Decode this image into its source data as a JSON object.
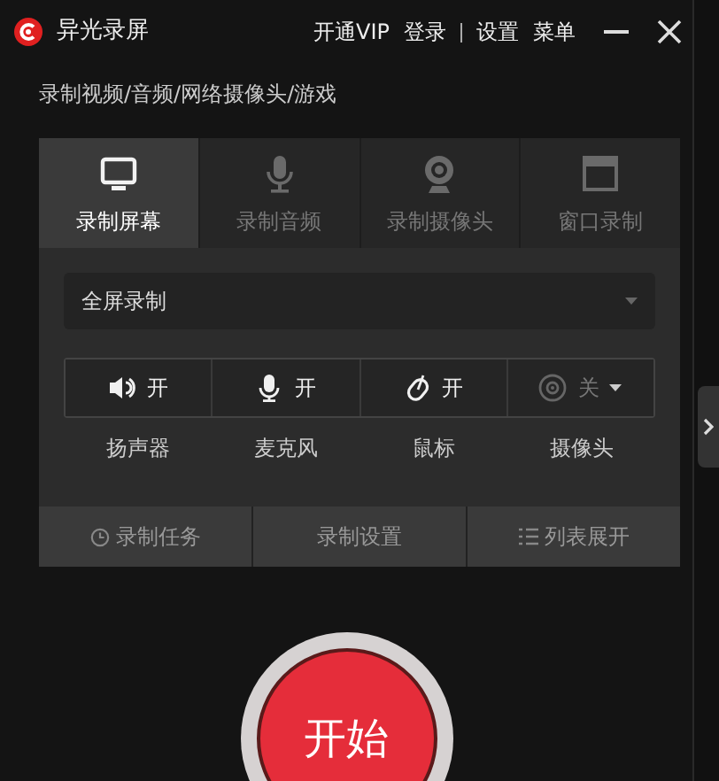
{
  "window": {
    "title": "异光录屏",
    "links": [
      "开通VIP",
      "登录",
      "设置",
      "菜单"
    ]
  },
  "subtitle": "录制视频/音频/网络摄像头/游戏",
  "tabs": [
    {
      "label": "录制屏幕",
      "selected": true
    },
    {
      "label": "录制音频",
      "selected": false
    },
    {
      "label": "录制摄像头",
      "selected": false
    },
    {
      "label": "窗口录制",
      "selected": false
    }
  ],
  "mode_select": {
    "value": "全屏录制"
  },
  "devices": [
    {
      "state": "开",
      "on": true,
      "has_menu": false,
      "label": "扬声器"
    },
    {
      "state": "开",
      "on": true,
      "has_menu": false,
      "label": "麦克风"
    },
    {
      "state": "开",
      "on": true,
      "has_menu": false,
      "label": "鼠标"
    },
    {
      "state": "关",
      "on": false,
      "has_menu": true,
      "label": "摄像头"
    }
  ],
  "bottom_buttons": [
    "录制任务",
    "录制设置",
    "列表展开"
  ],
  "start_button": "开始"
}
